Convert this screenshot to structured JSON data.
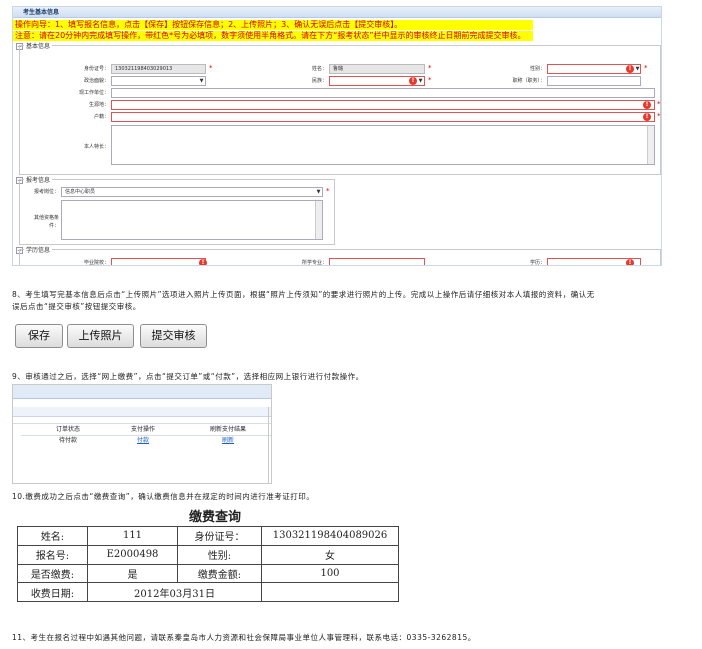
{
  "form": {
    "panel_title": "考生基本信息",
    "notice_line1": "操作向导：1、填写报名信息，点击【保存】按钮保存信息；2、上传照片；3、确认无误后点击【提交审核】。",
    "notice_line2": "注意：请在20分钟内完成填写操作，带红色*号为必填项，数字须使用半角格式。请在下方“报考状态”栏中显示的审核终止日期前完成提交审核。",
    "basic": {
      "legend": "基本信息",
      "id_label": "身份证号：",
      "id_value": "130321198403029013",
      "name_label": "姓名：",
      "name_value": "鲁璐",
      "gender_label": "性别：",
      "political_label": "政治面貌：",
      "ethnic_label": "民族：",
      "title_label": "职称（职务）：",
      "unit_label": "现工作单位：",
      "origin_label": "生源地：",
      "hukou_label": "户籍：",
      "resume_label": "本人特长："
    },
    "apply": {
      "legend": "报考信息",
      "position_label": "报考岗位：",
      "position_value": "信息中心职员",
      "other_label_1": "其他资格条",
      "other_label_2": "件："
    },
    "edu": {
      "legend": "学历信息",
      "grad_label": "毕业院校：",
      "major_label": "所学专业：",
      "degree_label": "学历："
    }
  },
  "steps": {
    "step8_line1": "8、考生填写完基本信息后点击“上传照片”选项进入照片上传页面，根据“照片上传须知”的要求进行照片的上传。完成以上操作后请仔细核对本人填报的资料，确认无",
    "step8_line2": "误后点击“提交审核”按钮提交审核。",
    "step9": "9、审核通过之后，选择“网上缴费”，点击“提交订单”或“付款”，选择相应网上银行进行付款操作。",
    "step10": "10.缴费成功之后点击“缴费查询”，确认缴费信息并在规定的时间内进行准考证打印。",
    "step11": "11、考生在报名过程中如遇其他问题，请联系秦皇岛市人力资源和社会保障局事业单位人事管理科，联系电话：0335-3262815。"
  },
  "buttons": {
    "save": "保存",
    "upload": "上传照片",
    "submit": "提交审核"
  },
  "payment": {
    "col_status": "订单状态",
    "col_action": "支付操作",
    "col_refresh": "刷新支付结果",
    "row_status": "待付款",
    "row_action": "付款",
    "row_refresh": "刷新"
  },
  "fee": {
    "title": "缴费查询",
    "name_label": "姓名:",
    "name_value": "111",
    "id_label": "身份证号：",
    "id_value": "130321198404089026",
    "reg_label": "报名号:",
    "reg_value": "E2000498",
    "gender_label": "性别:",
    "gender_value": "女",
    "paid_label": "是否缴费:",
    "paid_value": "是",
    "amount_label": "缴费金额:",
    "amount_value": "100",
    "date_label": "收费日期:",
    "date_value": "2012年03月31日"
  },
  "colors": {
    "required_border": "#e05353",
    "notice_bg": "#ffff00",
    "notice_text": "#d40000",
    "link": "#1f5fbf"
  }
}
